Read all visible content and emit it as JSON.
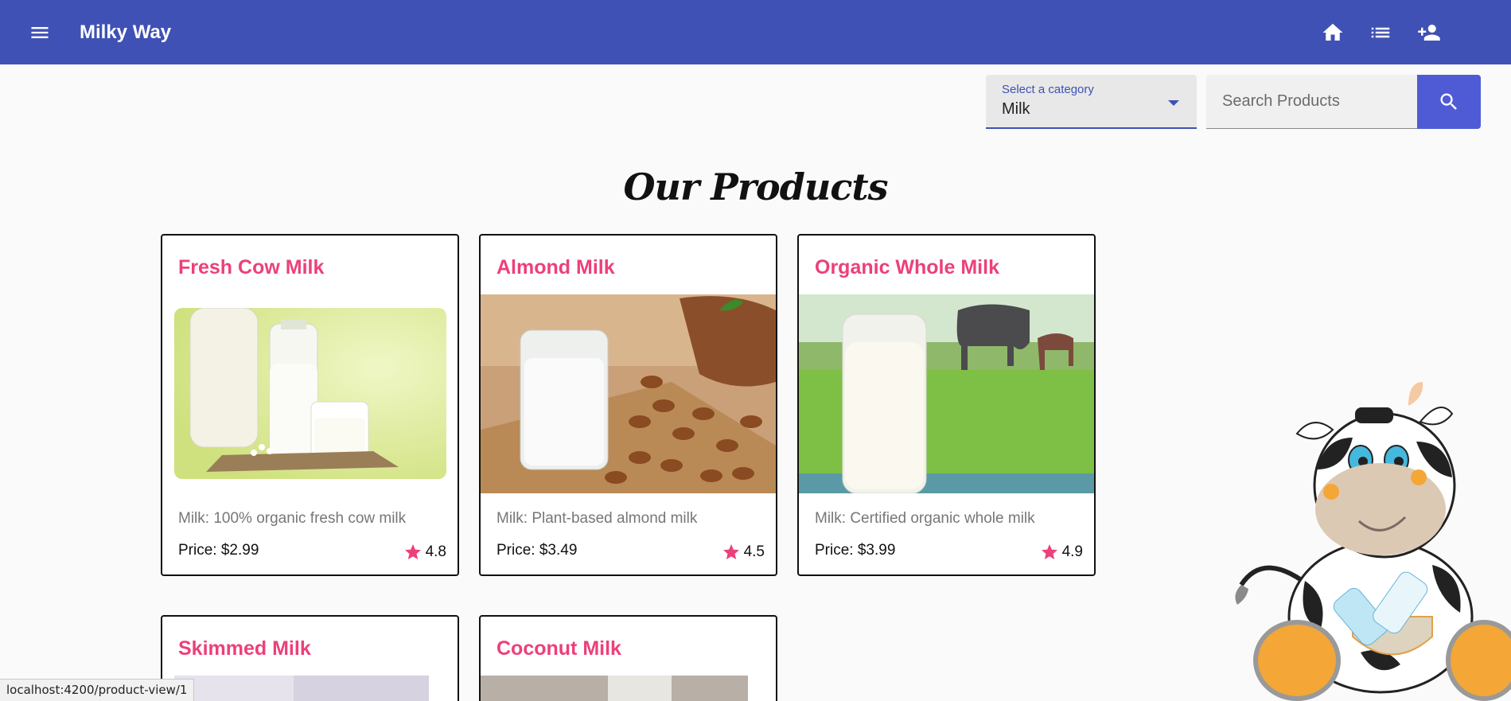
{
  "app": {
    "title": "Milky Way"
  },
  "toolbar": {
    "icons": [
      "menu-icon",
      "home-icon",
      "list-icon",
      "person-add-icon"
    ]
  },
  "filter": {
    "category_label": "Select a category",
    "category_value": "Milk",
    "search_placeholder": "Search Products",
    "search_value": ""
  },
  "main": {
    "heading": "Our Products"
  },
  "products": [
    {
      "name": "Fresh Cow Milk",
      "description": "Milk: 100% organic fresh cow milk",
      "price": "Price: $2.99",
      "rating": "4.8"
    },
    {
      "name": "Almond Milk",
      "description": "Milk: Plant-based almond milk",
      "price": "Price: $3.49",
      "rating": "4.5"
    },
    {
      "name": "Organic Whole Milk",
      "description": "Milk: Certified organic whole milk",
      "price": "Price: $3.99",
      "rating": "4.9"
    },
    {
      "name": "Skimmed Milk"
    },
    {
      "name": "Coconut Milk"
    }
  ],
  "status_bar": {
    "url": "localhost:4200/product-view/1"
  },
  "colors": {
    "primary": "#3f51b5",
    "accent": "#ec407a",
    "search_button": "#4f5bd5"
  }
}
